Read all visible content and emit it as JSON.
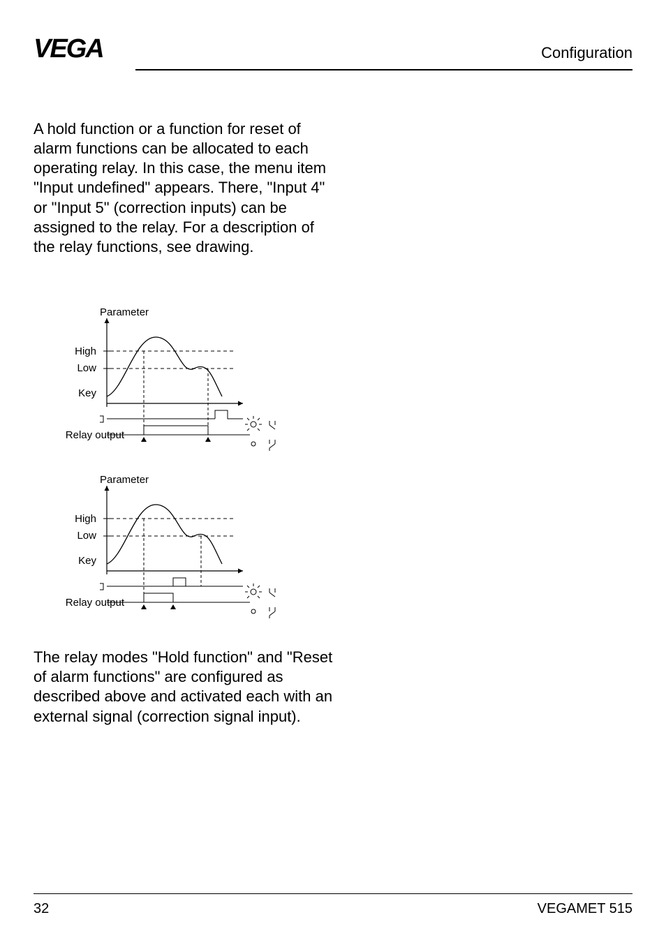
{
  "header": {
    "section": "Configuration"
  },
  "paragraph1": "A hold function or a function for reset of alarm functions can be allocated to each operating relay. In this case, the menu item \"Input undefined\" appears. There, \"Input 4\" or \"Input 5\" (correction inputs) can be assigned to the relay. For a description of the relay functions, see drawing.",
  "paragraph2": "The relay modes \"Hold function\" and \"Reset of alarm functions\" are configured as described above and activated each with an external signal (correction signal input).",
  "diagram_labels": {
    "parameter": "Parameter",
    "high": "High",
    "low": "Low",
    "key": "Key",
    "relay_output": "Relay output"
  },
  "footer": {
    "page": "32",
    "product": "VEGAMET 515"
  }
}
